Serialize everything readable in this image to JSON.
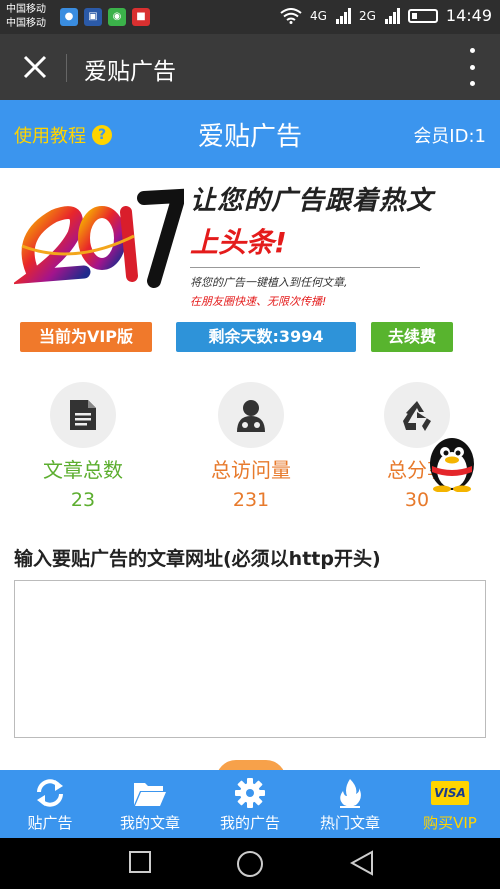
{
  "status_bar": {
    "carrier_1": "中国移动",
    "carrier_2": "中国移动",
    "net_1": "4G",
    "net_2": "2G",
    "time": "14:49"
  },
  "app_bar": {
    "title": "爱贴广告"
  },
  "header": {
    "tutorial_label": "使用教程",
    "title": "爱贴广告",
    "member_id": "会员ID:1"
  },
  "banner": {
    "year": "2017",
    "line1": "让您的广告跟着热文",
    "line2": "上头条!",
    "line3": "将您的广告一键植入到任何文章,",
    "line4": "在朋友圈快速、无限次传播!"
  },
  "badges": {
    "vip": "当前为VIP版",
    "days": "剩余天数:3994",
    "renew": "去续费"
  },
  "stats": [
    {
      "label": "文章总数",
      "value": "23",
      "icon": "document-icon"
    },
    {
      "label": "总访问量",
      "value": "231",
      "icon": "visitor-icon"
    },
    {
      "label": "总分享",
      "value": "30",
      "icon": "recycle-icon"
    }
  ],
  "input": {
    "label": "输入要贴广告的文章网址(必须以http开头)",
    "value": ""
  },
  "bottom_nav": [
    {
      "label": "贴广告",
      "icon": "refresh-icon"
    },
    {
      "label": "我的文章",
      "icon": "folder-icon"
    },
    {
      "label": "我的广告",
      "icon": "gear-icon"
    },
    {
      "label": "热门文章",
      "icon": "flame-icon"
    },
    {
      "label": "购买VIP",
      "icon": "visa-icon",
      "badge": "VISA"
    }
  ],
  "colors": {
    "header_blue": "#3b95ee",
    "tutorial_yellow": "#ffd400",
    "vip_orange": "#f0792b",
    "days_blue": "#2e93d9",
    "renew_green": "#58b42e",
    "stat_green": "#5cae2f",
    "stat_orange": "#e77a2c"
  }
}
